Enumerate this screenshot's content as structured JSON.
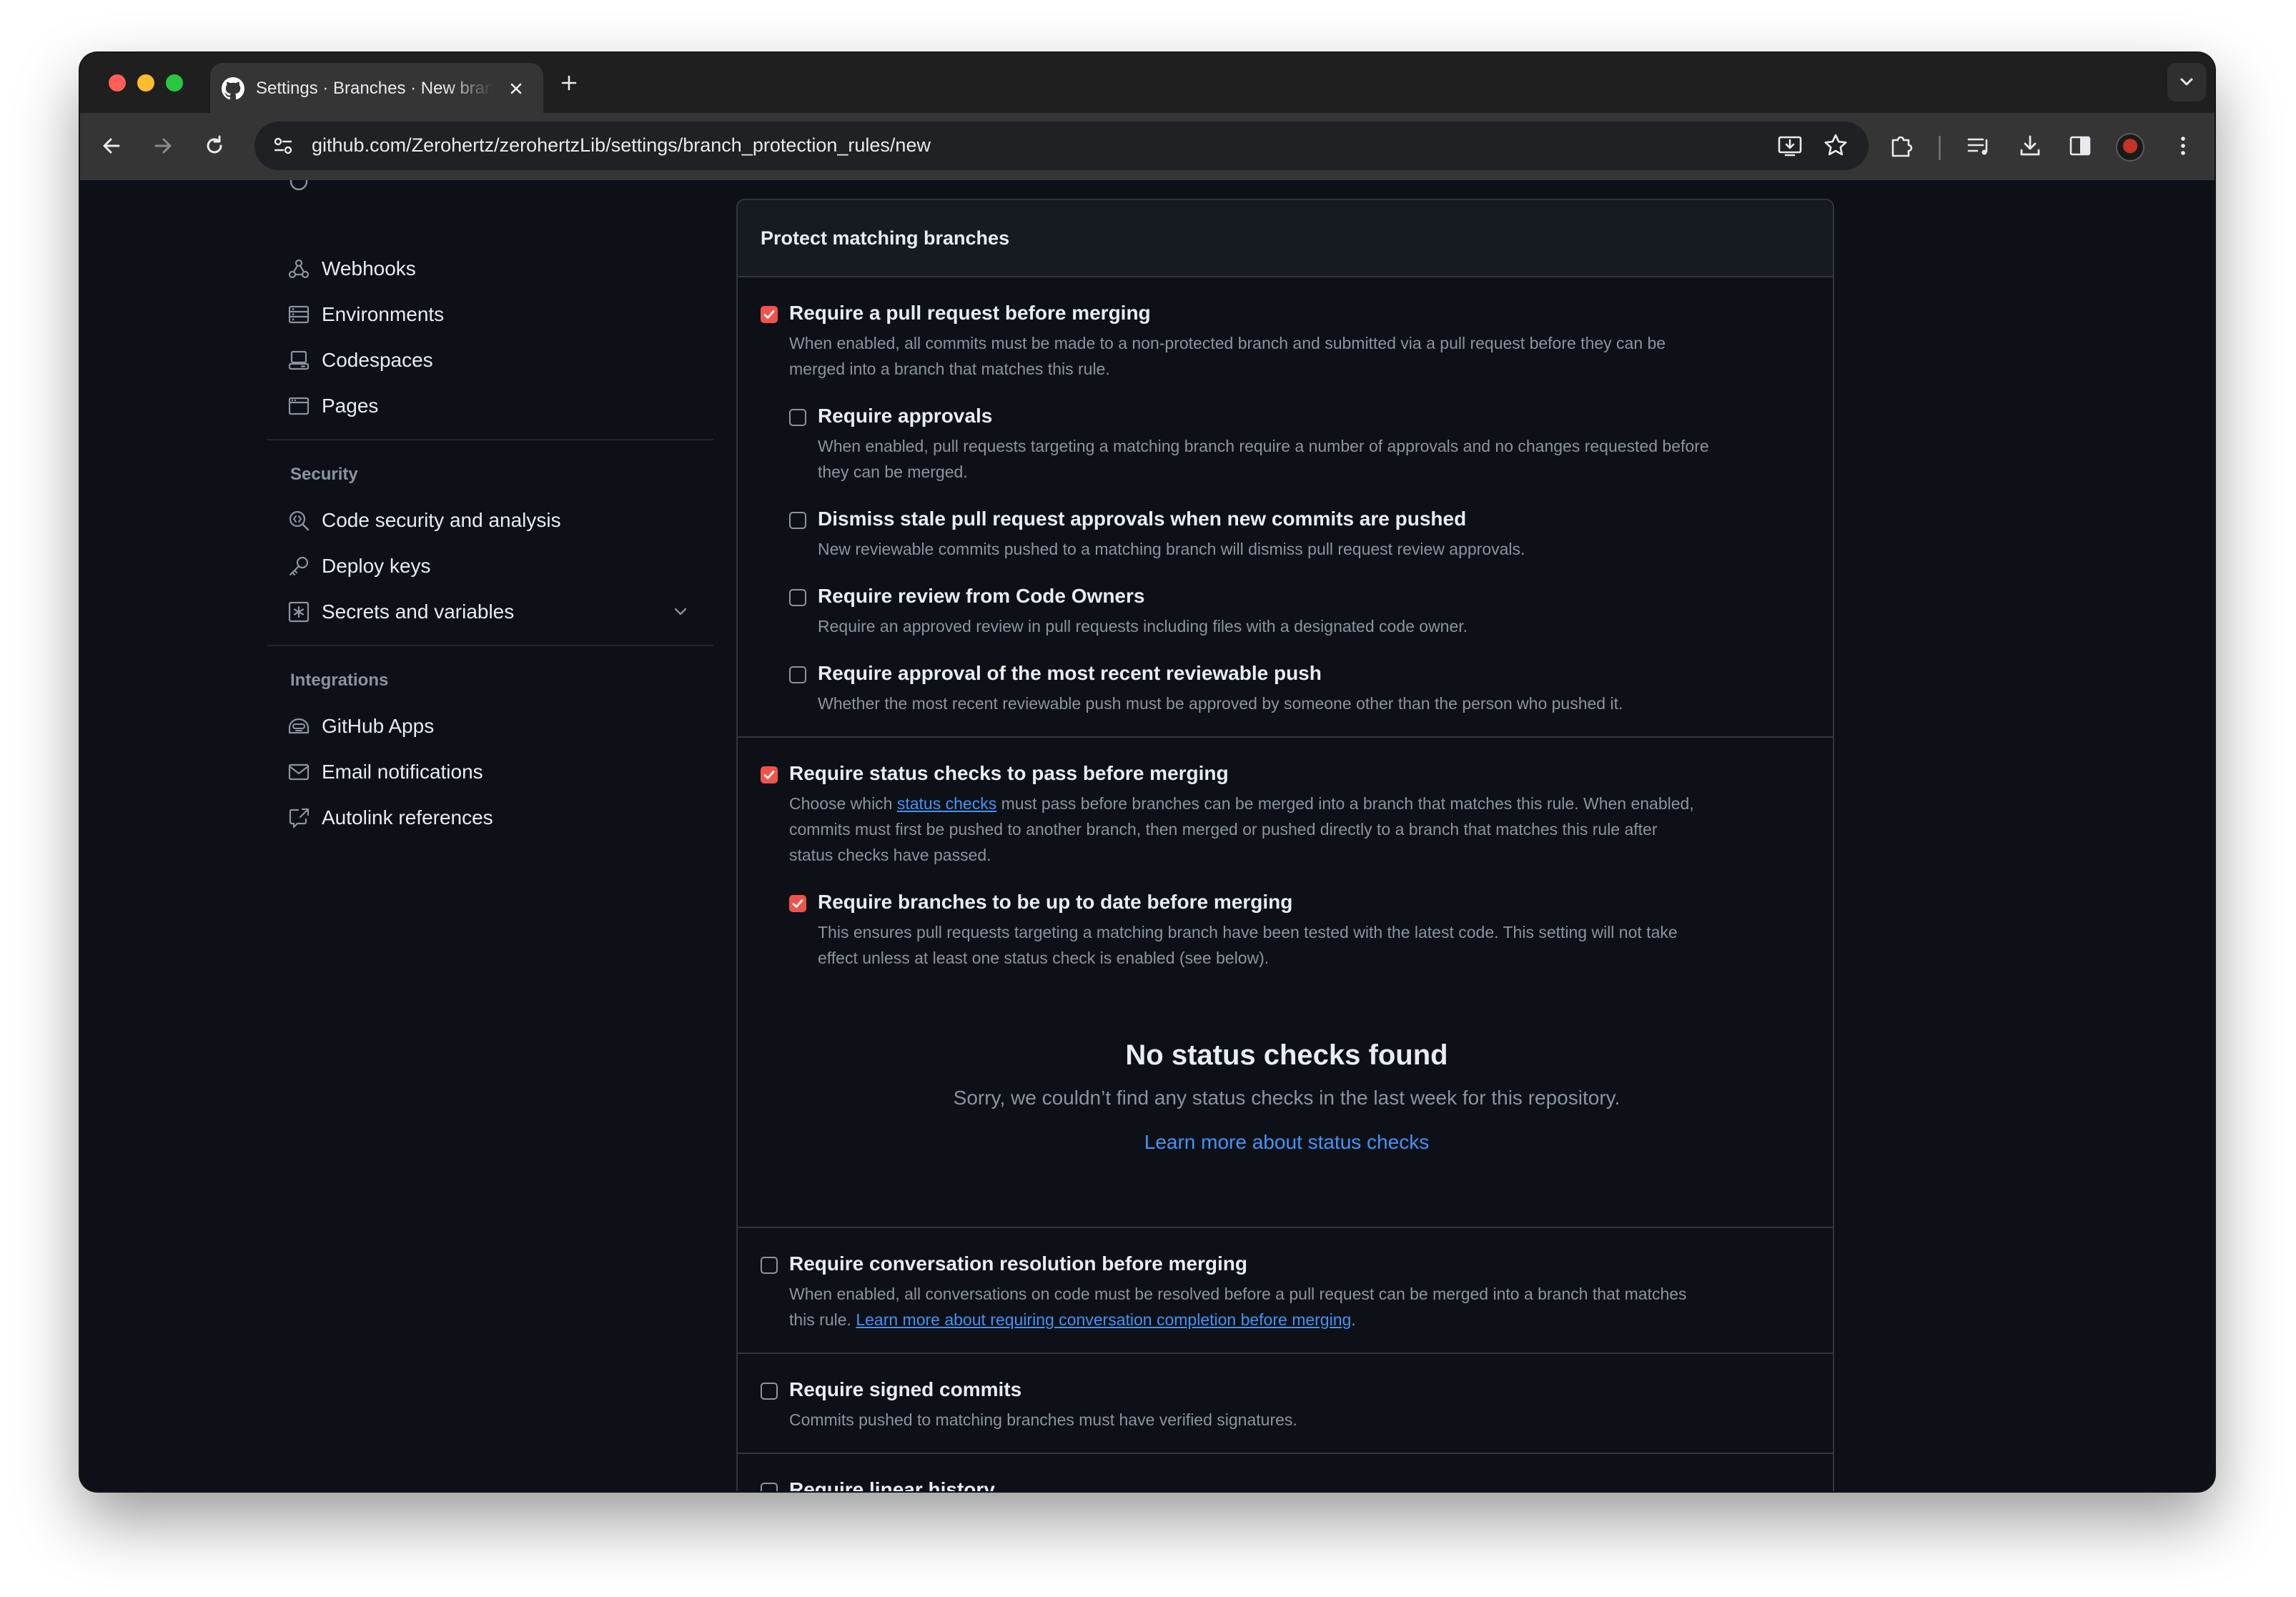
{
  "browser": {
    "tab_title": "Settings · Branches · New branch protection rule",
    "url": "github.com/Zerohertz/zerohertzLib/settings/branch_protection_rules/new",
    "colors": {
      "close": "#ff5f57",
      "minimize": "#febc2e",
      "zoom": "#28c840"
    }
  },
  "sidebar": {
    "items_top": [
      {
        "label": "Webhooks",
        "icon": "webhook-icon"
      },
      {
        "label": "Environments",
        "icon": "server-icon"
      },
      {
        "label": "Codespaces",
        "icon": "codespaces-icon"
      },
      {
        "label": "Pages",
        "icon": "browser-icon"
      }
    ],
    "security": {
      "heading": "Security",
      "items": [
        {
          "label": "Code security and analysis",
          "icon": "codescan-icon"
        },
        {
          "label": "Deploy keys",
          "icon": "key-icon"
        },
        {
          "label": "Secrets and variables",
          "icon": "key-asterisk-icon"
        }
      ]
    },
    "integrations": {
      "heading": "Integrations",
      "items": [
        {
          "label": "GitHub Apps",
          "icon": "hubot-icon"
        },
        {
          "label": "Email notifications",
          "icon": "mail-icon"
        },
        {
          "label": "Autolink references",
          "icon": "cross-reference-icon"
        }
      ]
    }
  },
  "panel": {
    "header": "Protect matching branches",
    "require_pr": {
      "checked": true,
      "label": "Require a pull request before merging",
      "desc1": "When enabled, all commits must be made to a non-protected branch and submitted via a pull request before they can be",
      "desc2": "merged into a branch that matches this rule."
    },
    "require_approvals": {
      "checked": false,
      "label": "Require approvals",
      "desc1": "When enabled, pull requests targeting a matching branch require a number of approvals and no changes requested before",
      "desc2": "they can be merged."
    },
    "dismiss_stale": {
      "checked": false,
      "label": "Dismiss stale pull request approvals when new commits are pushed",
      "desc": "New reviewable commits pushed to a matching branch will dismiss pull request review approvals."
    },
    "code_owners": {
      "checked": false,
      "label": "Require review from Code Owners",
      "desc": "Require an approved review in pull requests including files with a designated code owner."
    },
    "recent_push": {
      "checked": false,
      "label": "Require approval of the most recent reviewable push",
      "desc": "Whether the most recent reviewable push must be approved by someone other than the person who pushed it."
    },
    "status_checks": {
      "checked": true,
      "label": "Require status checks to pass before merging",
      "desc_pre": "Choose which ",
      "desc_link": "status checks",
      "desc_post": " must pass before branches can be merged into a branch that matches this rule. When enabled,",
      "desc2": "commits must first be pushed to another branch, then merged or pushed directly to a branch that matches this rule after",
      "desc3": "status checks have passed."
    },
    "up_to_date": {
      "checked": true,
      "label": "Require branches to be up to date before merging",
      "desc1": "This ensures pull requests targeting a matching branch have been tested with the latest code. This setting will not take",
      "desc2": "effect unless at least one status check is enabled (see below)."
    },
    "empty": {
      "title": "No status checks found",
      "subtitle": "Sorry, we couldn’t find any status checks in the last week for this repository.",
      "link": "Learn more about status checks"
    },
    "conversation": {
      "checked": false,
      "label": "Require conversation resolution before merging",
      "desc1": "When enabled, all conversations on code must be resolved before a pull request can be merged into a branch that matches",
      "desc2_pre": "this rule. ",
      "desc2_link": "Learn more about requiring conversation completion before merging",
      "desc2_post": "."
    },
    "signed": {
      "checked": false,
      "label": "Require signed commits",
      "desc": "Commits pushed to matching branches must have verified signatures."
    },
    "linear": {
      "checked": false,
      "label": "Require linear history"
    }
  }
}
